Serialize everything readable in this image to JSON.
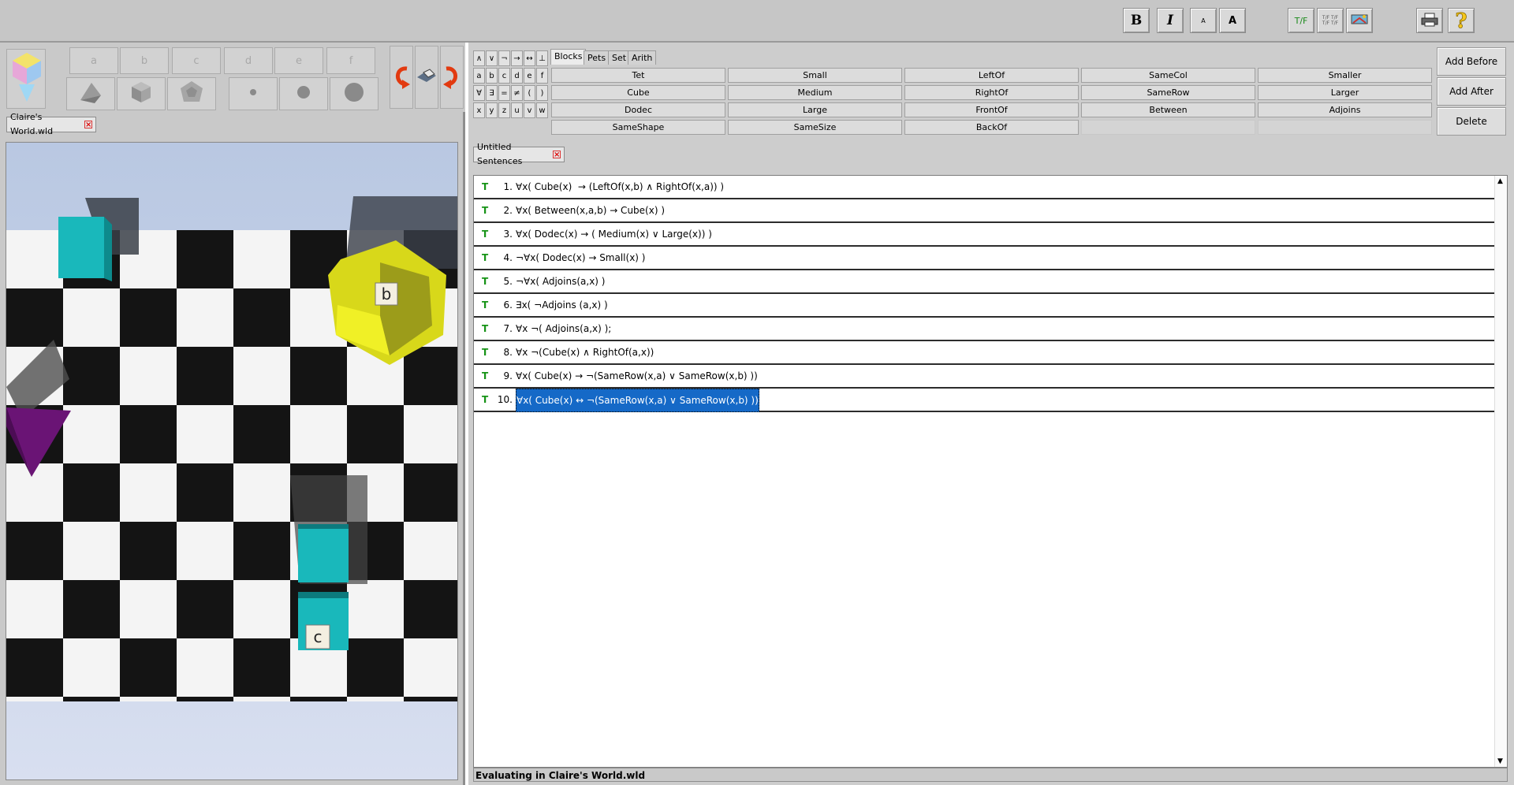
{
  "toolbar": {
    "bold_label": "B",
    "italic_label": "I",
    "font_small_label": "A",
    "font_large_label": "A",
    "tf_label": "T/F",
    "tf_multi_label": "T/F T/F T/F T/F"
  },
  "palette": {
    "name_buttons": [
      "a",
      "b",
      "c",
      "d",
      "e",
      "f"
    ]
  },
  "world_tab": {
    "label": "Claire's World.wld"
  },
  "world": {
    "label_b": "b",
    "label_c": "c"
  },
  "symbols": {
    "row1": [
      "∧",
      "∨",
      "¬",
      "→",
      "↔",
      "⊥"
    ],
    "row2": [
      "a",
      "b",
      "c",
      "d",
      "e",
      "f"
    ],
    "row3": [
      "∀",
      "∃",
      "=",
      "≠",
      "(",
      ")"
    ],
    "row4": [
      "x",
      "y",
      "z",
      "u",
      "v",
      "w"
    ]
  },
  "predicate_tabs": [
    "Blocks",
    "Pets",
    "Set",
    "Arith"
  ],
  "predicates": {
    "col1": [
      "Tet",
      "Cube",
      "Dodec",
      "SameShape"
    ],
    "col2": [
      "Small",
      "Medium",
      "Large",
      "SameSize"
    ],
    "col3": [
      "LeftOf",
      "RightOf",
      "FrontOf",
      "BackOf"
    ],
    "col4": [
      "SameCol",
      "SameRow",
      "Between",
      ""
    ],
    "col5": [
      "Smaller",
      "Larger",
      "Adjoins",
      ""
    ]
  },
  "side_buttons": {
    "add_before": "Add Before",
    "add_after": "Add After",
    "delete": "Delete"
  },
  "sentences_tab": {
    "label": "Untitled Sentences"
  },
  "sentences": [
    {
      "tv": "T",
      "num": "1.",
      "text": "∀x( Cube(x)  → (LeftOf(x,b) ∧ RightOf(x,a)) )"
    },
    {
      "tv": "T",
      "num": "2.",
      "text": "∀x( Between(x,a,b) → Cube(x) )"
    },
    {
      "tv": "T",
      "num": "3.",
      "text": "∀x( Dodec(x) → ( Medium(x) ∨ Large(x)) )"
    },
    {
      "tv": "T",
      "num": "4.",
      "text": "¬∀x( Dodec(x) → Small(x) )"
    },
    {
      "tv": "T",
      "num": "5.",
      "text": "¬∀x( Adjoins(a,x) )"
    },
    {
      "tv": "T",
      "num": "6.",
      "text": "∃x( ¬Adjoins (a,x) )"
    },
    {
      "tv": "T",
      "num": "7.",
      "text": "∀x ¬( Adjoins(a,x) );"
    },
    {
      "tv": "T",
      "num": "8.",
      "text": "∀x ¬(Cube(x) ∧ RightOf(a,x))"
    },
    {
      "tv": "T",
      "num": "9.",
      "text": "∀x( Cube(x) → ¬(SameRow(x,a) ∨ SameRow(x,b) ))"
    },
    {
      "tv": "T",
      "num": "10.",
      "text": "∀x( Cube(x) ↔ ¬(SameRow(x,a) ∨ SameRow(x,b) ))"
    }
  ],
  "status": {
    "text": "Evaluating in Claire's World.wld"
  },
  "colors": {
    "truth_green": "#169316",
    "selection_blue": "#1569c7",
    "cube_teal": "#16b9b9",
    "dodec_yellow": "#e8e81a",
    "tet_purple": "#6a1475"
  }
}
